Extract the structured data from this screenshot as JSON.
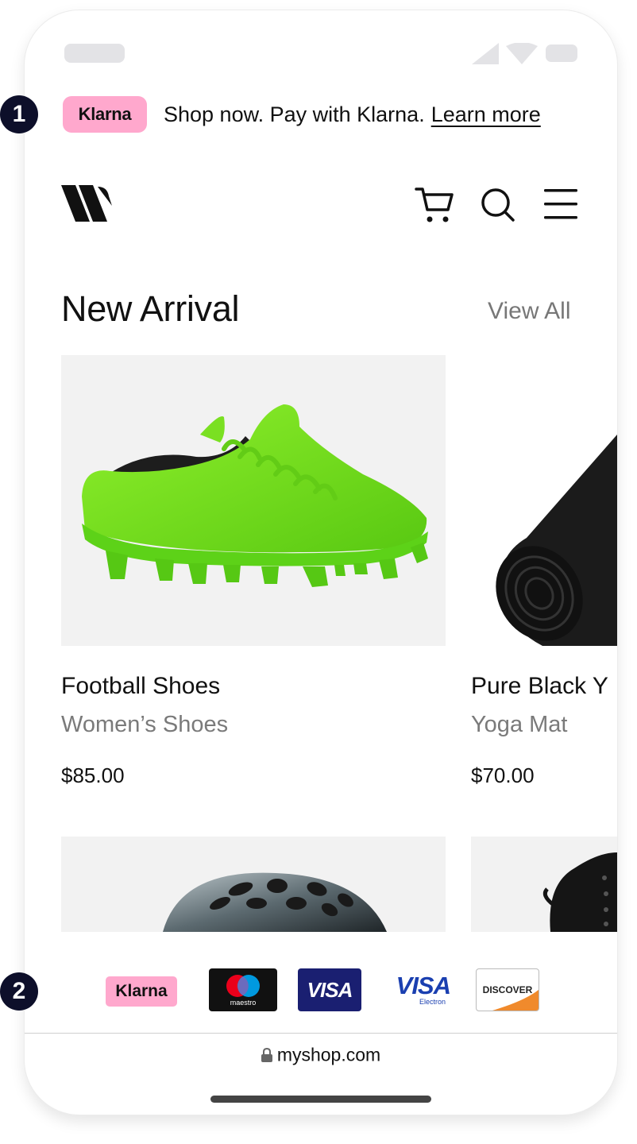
{
  "annotations": {
    "first": "1",
    "second": "2"
  },
  "banner": {
    "badge": "Klarna",
    "text": "Shop now. Pay with Klarna.",
    "link": "Learn more"
  },
  "section": {
    "title": "New Arrival",
    "view_all": "View All"
  },
  "products": [
    {
      "name": "Football Shoes",
      "category": "Women’s Shoes",
      "price": "$85.00",
      "image": "green-football-shoe"
    },
    {
      "name": "Pure Black Y",
      "category": "Yoga Mat",
      "price": "$70.00",
      "image": "black-yoga-mat"
    }
  ],
  "payments": {
    "klarna": "Klarna",
    "maestro": "maestro",
    "visa": "VISA",
    "visa_electron": "VISA",
    "visa_electron_sub": "Electron",
    "discover": "DISCOVER"
  },
  "browser": {
    "url": "myshop.com"
  },
  "colors": {
    "klarna_pink": "#ffa8cd",
    "accent_dark": "#0d0f2a",
    "visa_blue": "#1a1f71"
  }
}
